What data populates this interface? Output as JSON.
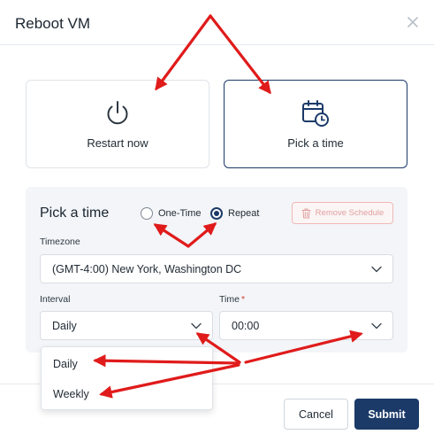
{
  "dialog": {
    "title": "Reboot VM"
  },
  "options": {
    "restart_label": "Restart now",
    "pick_label": "Pick a time",
    "restart_icon": "power-icon",
    "pick_icon": "calendar-clock-icon"
  },
  "schedule": {
    "title": "Pick a time",
    "one_time_label": "One-Time",
    "repeat_label": "Repeat",
    "remove_label": "Remove Schedule",
    "timezone_label": "Timezone",
    "timezone_value": "(GMT-4:00) New York, Washington DC",
    "interval_label": "Interval",
    "interval_value": "Daily",
    "interval_options": [
      "Daily",
      "Weekly"
    ],
    "time_label": "Time",
    "time_required_mark": "*",
    "time_value": "00:00"
  },
  "footer": {
    "cancel_label": "Cancel",
    "submit_label": "Submit"
  },
  "colors": {
    "primary": "#1b3a68",
    "annotation_arrow": "#e01b1b",
    "danger_soft": "#e2a0a0"
  }
}
